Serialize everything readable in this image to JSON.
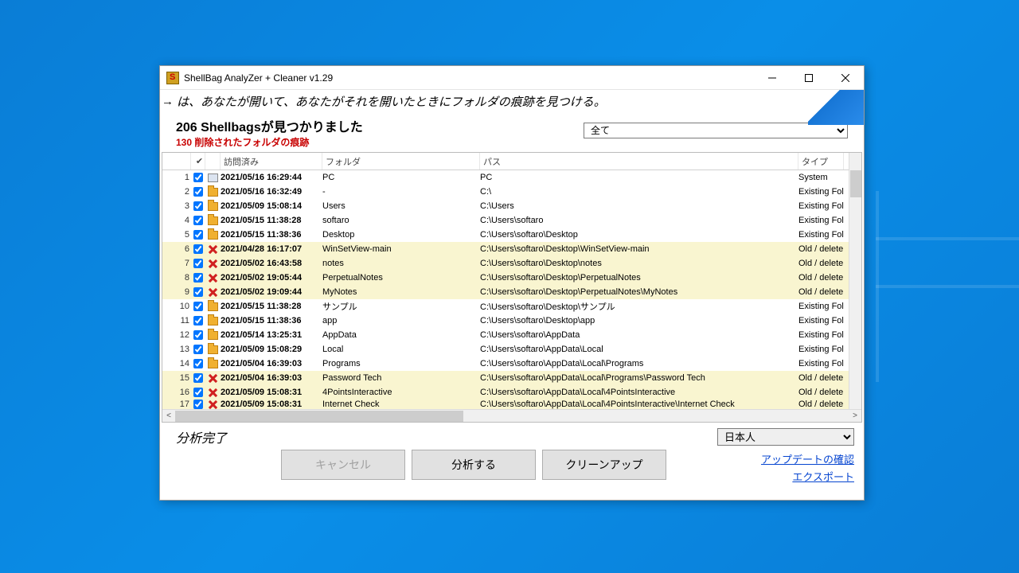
{
  "window": {
    "title": "ShellBag AnalyZer + Cleaner v1.29"
  },
  "subtitle": "は、あなたが開いて、あなたがそれを開いたときにフォルダの痕跡を見つける。",
  "summary": {
    "line1": "206 Shellbagsが見つかりました",
    "line2": "130 削除されたフォルダの痕跡"
  },
  "filter": {
    "selected": "全て"
  },
  "columns": {
    "check": "✔",
    "visited": "訪問済み",
    "folder": "フォルダ",
    "path": "パス",
    "type": "タイプ"
  },
  "rows": [
    {
      "n": 1,
      "chk": true,
      "icon": "pc",
      "date": "2021/05/16 16:29:44",
      "folder": "PC",
      "path": "PC",
      "type": "System",
      "deleted": false
    },
    {
      "n": 2,
      "chk": true,
      "icon": "folder",
      "date": "2021/05/16 16:32:49",
      "folder": "-",
      "path": "C:\\",
      "type": "Existing Fol",
      "deleted": false
    },
    {
      "n": 3,
      "chk": true,
      "icon": "folder",
      "date": "2021/05/09 15:08:14",
      "folder": "Users",
      "path": "C:\\Users",
      "type": "Existing Fol",
      "deleted": false
    },
    {
      "n": 4,
      "chk": true,
      "icon": "folder",
      "date": "2021/05/15 11:38:28",
      "folder": "softaro",
      "path": "C:\\Users\\softaro",
      "type": "Existing Fol",
      "deleted": false
    },
    {
      "n": 5,
      "chk": true,
      "icon": "folder",
      "date": "2021/05/15 11:38:36",
      "folder": "Desktop",
      "path": "C:\\Users\\softaro\\Desktop",
      "type": "Existing Fol",
      "deleted": false
    },
    {
      "n": 6,
      "chk": true,
      "icon": "x",
      "date": "2021/04/28 16:17:07",
      "folder": "WinSetView-main",
      "path": "C:\\Users\\softaro\\Desktop\\WinSetView-main",
      "type": "Old / delete",
      "deleted": true
    },
    {
      "n": 7,
      "chk": true,
      "icon": "x",
      "date": "2021/05/02 16:43:58",
      "folder": "notes",
      "path": "C:\\Users\\softaro\\Desktop\\notes",
      "type": "Old / delete",
      "deleted": true
    },
    {
      "n": 8,
      "chk": true,
      "icon": "x",
      "date": "2021/05/02 19:05:44",
      "folder": "PerpetualNotes",
      "path": "C:\\Users\\softaro\\Desktop\\PerpetualNotes",
      "type": "Old / delete",
      "deleted": true
    },
    {
      "n": 9,
      "chk": true,
      "icon": "x",
      "date": "2021/05/02 19:09:44",
      "folder": "MyNotes",
      "path": "C:\\Users\\softaro\\Desktop\\PerpetualNotes\\MyNotes",
      "type": "Old / delete",
      "deleted": true
    },
    {
      "n": 10,
      "chk": true,
      "icon": "folder",
      "date": "2021/05/15 11:38:28",
      "folder": "サンプル",
      "path": "C:\\Users\\softaro\\Desktop\\サンプル",
      "type": "Existing Fol",
      "deleted": false
    },
    {
      "n": 11,
      "chk": true,
      "icon": "folder",
      "date": "2021/05/15 11:38:36",
      "folder": "app",
      "path": "C:\\Users\\softaro\\Desktop\\app",
      "type": "Existing Fol",
      "deleted": false
    },
    {
      "n": 12,
      "chk": true,
      "icon": "folder",
      "date": "2021/05/14 13:25:31",
      "folder": "AppData",
      "path": "C:\\Users\\softaro\\AppData",
      "type": "Existing Fol",
      "deleted": false
    },
    {
      "n": 13,
      "chk": true,
      "icon": "folder",
      "date": "2021/05/09 15:08:29",
      "folder": "Local",
      "path": "C:\\Users\\softaro\\AppData\\Local",
      "type": "Existing Fol",
      "deleted": false
    },
    {
      "n": 14,
      "chk": true,
      "icon": "folder",
      "date": "2021/05/04 16:39:03",
      "folder": "Programs",
      "path": "C:\\Users\\softaro\\AppData\\Local\\Programs",
      "type": "Existing Fol",
      "deleted": false
    },
    {
      "n": 15,
      "chk": true,
      "icon": "x",
      "date": "2021/05/04 16:39:03",
      "folder": "Password Tech",
      "path": "C:\\Users\\softaro\\AppData\\Local\\Programs\\Password Tech",
      "type": "Old / delete",
      "deleted": true
    },
    {
      "n": 16,
      "chk": true,
      "icon": "x",
      "date": "2021/05/09 15:08:31",
      "folder": "4PointsInteractive",
      "path": "C:\\Users\\softaro\\AppData\\Local\\4PointsInteractive",
      "type": "Old / delete",
      "deleted": true
    },
    {
      "n": 17,
      "chk": true,
      "icon": "x",
      "date": "2021/05/09 15:08:31",
      "folder": "Internet Check",
      "path": "C:\\Users\\softaro\\AppData\\Local\\4PointsInteractive\\Internet Check",
      "type": "Old / delete",
      "deleted": true,
      "cut": true
    }
  ],
  "status": "分析完了",
  "language": {
    "selected": "日本人"
  },
  "buttons": {
    "cancel": {
      "label": "キャンセル",
      "enabled": false
    },
    "analyze": {
      "label": "分析する",
      "enabled": true
    },
    "cleanup": {
      "label": "クリーンアップ",
      "enabled": true
    }
  },
  "links": {
    "update": "アップデートの確認",
    "export": "エクスポート"
  }
}
